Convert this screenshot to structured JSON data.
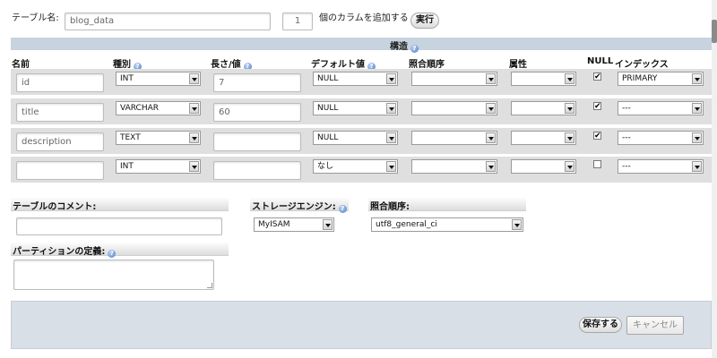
{
  "top": {
    "table_name_label": "テーブル名:",
    "table_name_value": "blog_data",
    "add_columns_value": "1",
    "add_columns_label": "個のカラムを追加する",
    "go_button": "実行"
  },
  "structure_title": "構造",
  "columns": {
    "name": "名前",
    "type": "種別",
    "length": "長さ/値",
    "default": "デフォルト値",
    "collation": "照合順序",
    "attributes": "属性",
    "null": "NULL",
    "index": "インデックス"
  },
  "rows": [
    {
      "name": "id",
      "type": "INT",
      "length": "7",
      "default": "NULL",
      "collation": "",
      "attributes": "",
      "null_checked": "✔",
      "index": "PRIMARY"
    },
    {
      "name": "title",
      "type": "VARCHAR",
      "length": "60",
      "default": "NULL",
      "collation": "",
      "attributes": "",
      "null_checked": "✔",
      "index": "---"
    },
    {
      "name": "description",
      "type": "TEXT",
      "length": "",
      "default": "NULL",
      "collation": "",
      "attributes": "",
      "null_checked": "✔",
      "index": "---"
    },
    {
      "name": "",
      "type": "INT",
      "length": "",
      "default": "なし",
      "collation": "",
      "attributes": "",
      "null_checked": "",
      "index": "---"
    }
  ],
  "table_comment": {
    "label": "テーブルのコメント:",
    "value": ""
  },
  "storage_engine": {
    "label": "ストレージエンジン:",
    "value": "MyISAM"
  },
  "collation": {
    "label": "照合順序:",
    "value": "utf8_general_ci"
  },
  "partition": {
    "label": "パーティションの定義:",
    "value": ""
  },
  "footer": {
    "save_button": "保存する",
    "cancel_button": "キャンセル"
  },
  "colors": {
    "header_band": "#c7d3de",
    "row_band": "#dfdfdf",
    "footer_band": "#d9dfe6",
    "help_icon": "#4f7fc9"
  }
}
